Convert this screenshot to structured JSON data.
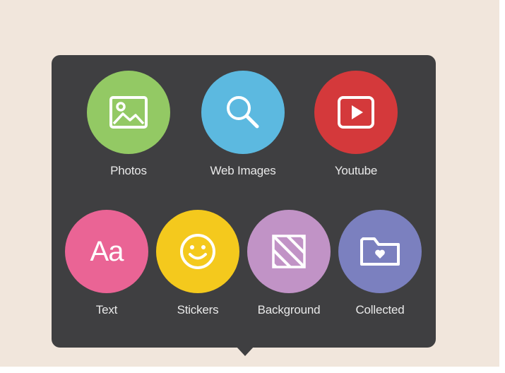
{
  "popover": {
    "row1": [
      {
        "label": "Photos",
        "color": "#93c964",
        "icon": "image-icon"
      },
      {
        "label": "Web Images",
        "color": "#5cb9e0",
        "icon": "search-icon"
      },
      {
        "label": "Youtube",
        "color": "#d4393b",
        "icon": "play-icon"
      }
    ],
    "row2": [
      {
        "label": "Text",
        "color": "#ea6495",
        "icon": "text-aa-icon"
      },
      {
        "label": "Stickers",
        "color": "#f4c91d",
        "icon": "smiley-icon"
      },
      {
        "label": "Background",
        "color": "#c193c6",
        "icon": "pattern-icon"
      },
      {
        "label": "Collected",
        "color": "#7b80bf",
        "icon": "folder-heart-icon"
      }
    ],
    "text_icon_glyph": "Aa"
  }
}
